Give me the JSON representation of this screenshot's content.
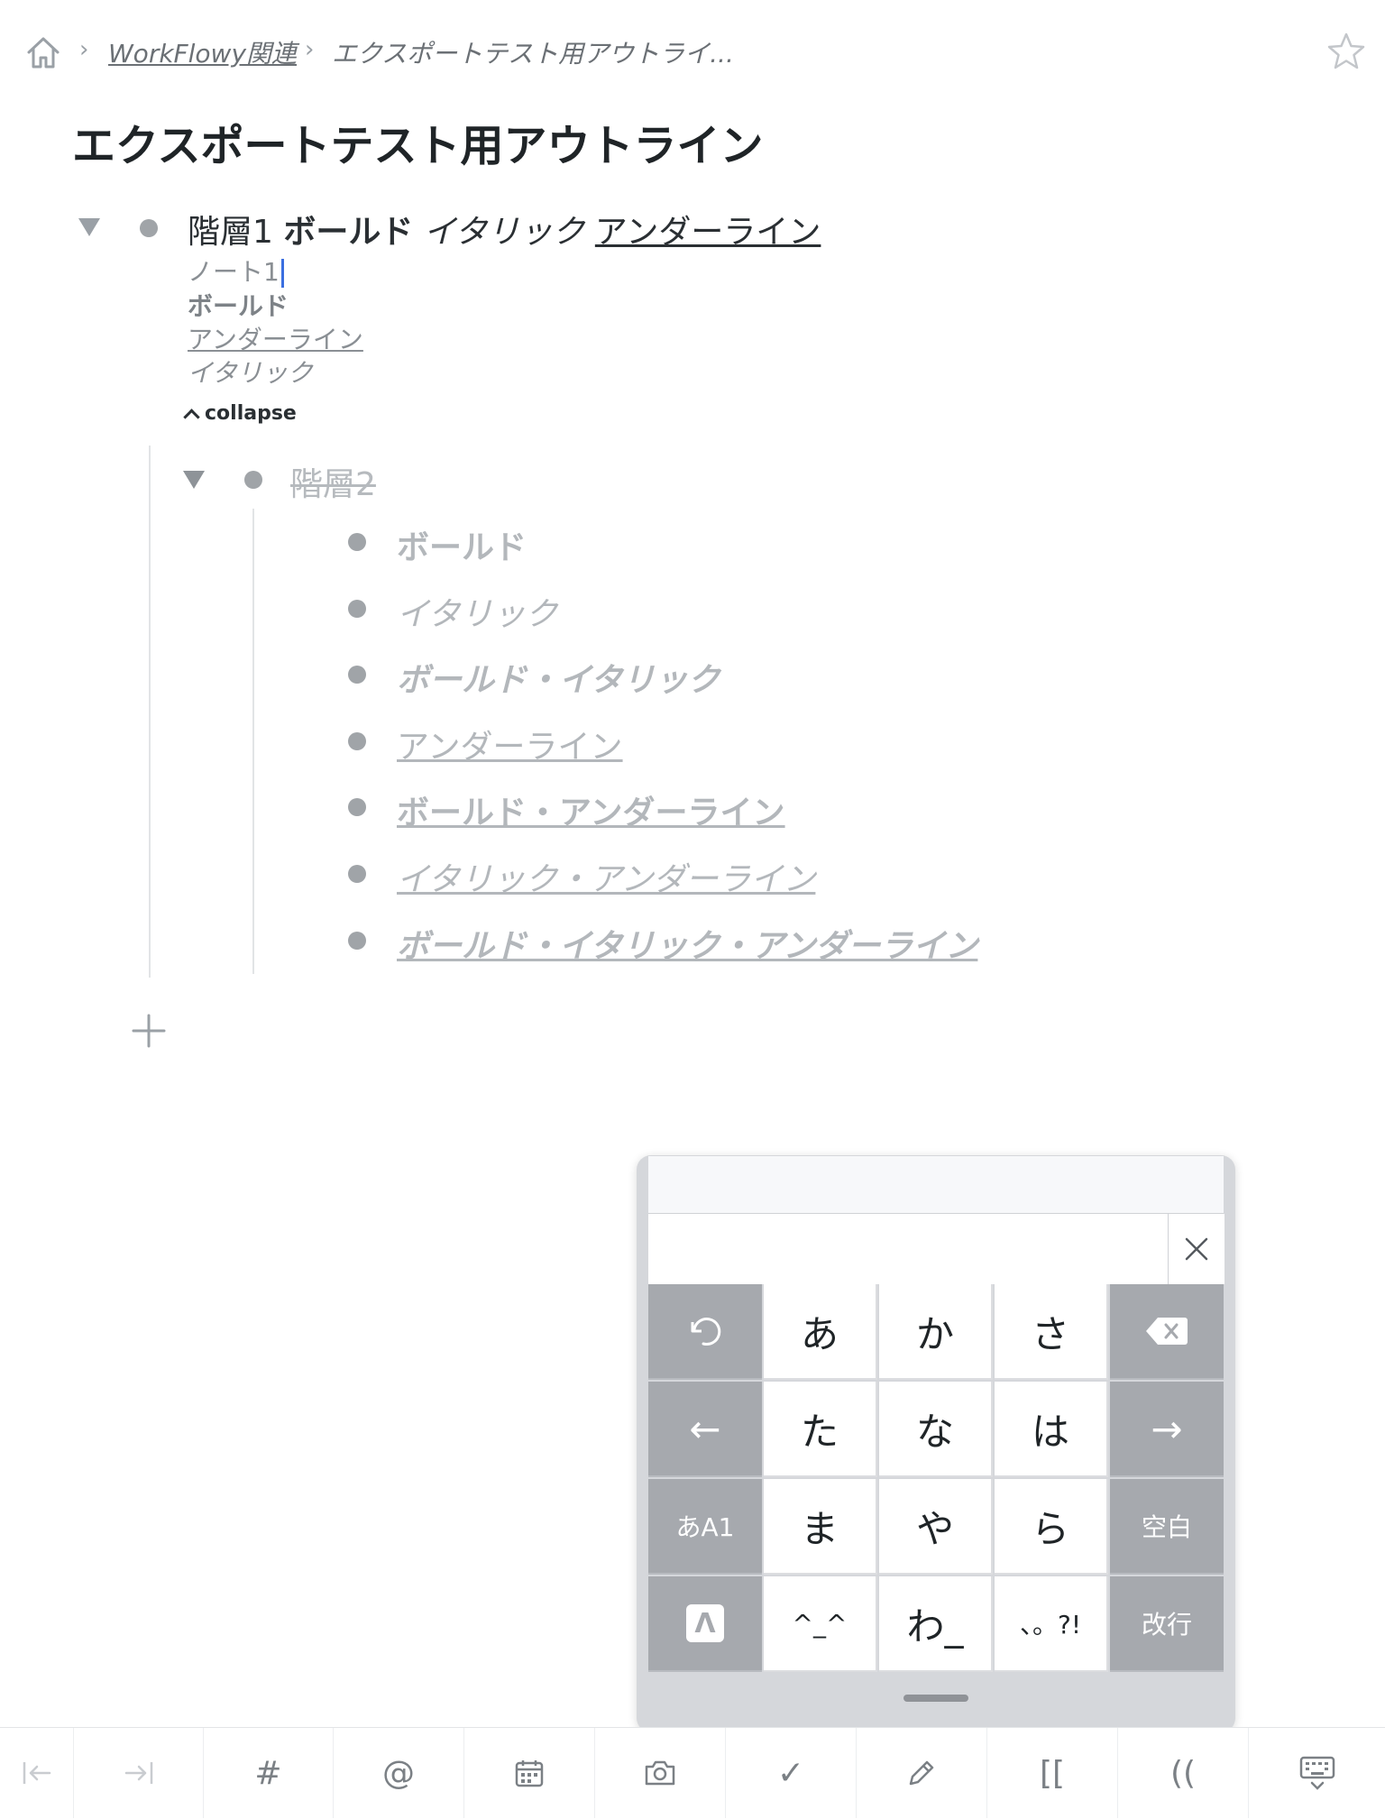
{
  "breadcrumb": {
    "home_icon": "home-icon",
    "parent_link": "WorkFlowy関連",
    "current": "エクスポートテスト用アウトライ...",
    "star_icon": "star-icon"
  },
  "page": {
    "title": "エクスポートテスト用アウトライン"
  },
  "outline": {
    "level1": {
      "prefix": "階層1",
      "bold": "ボールド",
      "italic": "イタリック",
      "underline": "アンダーライン",
      "notes": [
        "ノート1",
        "ボールド",
        "アンダーライン",
        "イタリック"
      ],
      "collapse_label": "collapse"
    },
    "level2": {
      "label": "階層2",
      "completed": true,
      "children": [
        "ボールド",
        "イタリック",
        "ボールド・イタリック",
        "アンダーライン",
        "ボールド・アンダーライン",
        "イタリック・アンダーライン",
        "ボールド・イタリック・アンダーライン"
      ]
    },
    "add_icon": "plus-icon"
  },
  "keyboard": {
    "rows": [
      [
        "↺",
        "あ",
        "か",
        "さ",
        "⌫"
      ],
      [
        "←",
        "た",
        "な",
        "は",
        "→"
      ],
      [
        "あA1",
        "ま",
        "や",
        "ら",
        "空白"
      ],
      [
        "Λ",
        "^_^",
        "わ_",
        "、。?!",
        "改行"
      ]
    ]
  },
  "toolbar": {
    "outdent_icon": "outdent-icon",
    "indent_icon": "indent-icon",
    "tag": "#",
    "mention": "@",
    "calendar_icon": "calendar-icon",
    "camera_icon": "camera-icon",
    "check": "✓",
    "pencil_icon": "pencil-icon",
    "link_open": "[[",
    "mirror_open": "((",
    "keyboard_icon": "keyboard-icon"
  }
}
